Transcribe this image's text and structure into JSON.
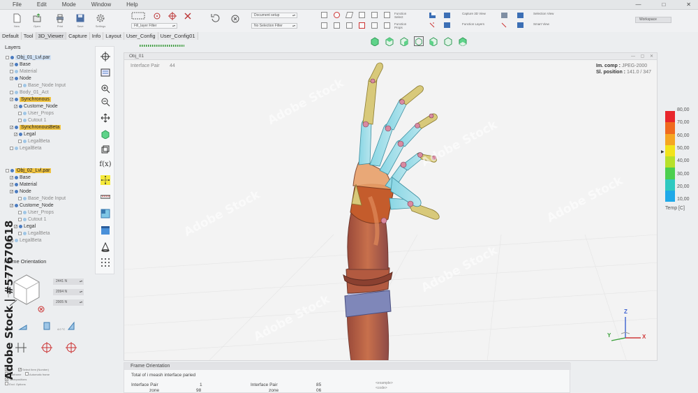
{
  "menu": [
    "File",
    "Edit",
    "Mode",
    "Window",
    "Help"
  ],
  "ribbon": {
    "buttons": [
      "New",
      "Open",
      "Print",
      "Save",
      "Settings"
    ],
    "layer_filter": "Fill_layer Filter",
    "document_setup": "Document setup",
    "selection_filter": "No Selection Filter",
    "function_select": "Function Select",
    "function_props": "Function Props",
    "capture_3d_view": "Capture 3D View",
    "function_layers": "Function Layers",
    "selection_view": "Selection View",
    "smart_view": "Smart View",
    "workspace": "Workspace"
  },
  "tabs": [
    "Default",
    "Tool",
    "3D_Viewer",
    "Capture",
    "Info",
    "Layout",
    "User_Config",
    "User_Config01"
  ],
  "layers": {
    "title": "Layers",
    "tree": [
      {
        "label": "Obj_01_Lvl.par",
        "style": "blue",
        "indent": 0
      },
      {
        "label": "Base",
        "indent": 1
      },
      {
        "label": "Material",
        "indent": 1,
        "dim": true
      },
      {
        "label": "Node",
        "indent": 1
      },
      {
        "label": "Base_Node Input",
        "indent": 3,
        "dim": true
      },
      {
        "label": "Body_01_Act",
        "indent": 1,
        "dim": true
      },
      {
        "label": "Synchronous",
        "indent": 1,
        "style": "yellow"
      },
      {
        "label": "Custome_Node",
        "indent": 2
      },
      {
        "label": "User_Props",
        "indent": 3,
        "dim": true
      },
      {
        "label": "Cutout 1",
        "indent": 3,
        "dim": true
      },
      {
        "label": "SynchronousBeta",
        "indent": 1,
        "style": "yellow"
      },
      {
        "label": "Legal",
        "indent": 2
      },
      {
        "label": "LegalBeta",
        "indent": 3,
        "dim": true
      },
      {
        "label": "LegalBeta",
        "indent": 1,
        "dim": true
      },
      {
        "label": "Obj_02_Lvl.par",
        "style": "yellow",
        "indent": 0
      },
      {
        "label": "Base",
        "indent": 1
      },
      {
        "label": "Material",
        "indent": 1
      },
      {
        "label": "Node",
        "indent": 1
      },
      {
        "label": "Base_Node Input",
        "indent": 3,
        "dim": true
      },
      {
        "label": "Custome_Node",
        "indent": 1
      },
      {
        "label": "User_Props",
        "indent": 3,
        "dim": true
      },
      {
        "label": "Cutout 1",
        "indent": 3,
        "dim": true
      },
      {
        "label": "Legal",
        "indent": 2
      },
      {
        "label": "LegalBeta",
        "indent": 3,
        "dim": true
      },
      {
        "label": "LegalBeta",
        "indent": 1,
        "dim": true
      }
    ]
  },
  "frame_orientation": {
    "title": "Frame Orientation",
    "values": [
      "2441 N",
      "2094 N",
      "2005 N"
    ],
    "angles": [
      "7.0 °C",
      "4.0 °C"
    ],
    "options": [
      "Rel.",
      "Select Item (Number)",
      "Automatic frame",
      "Subframe",
      "Tablepositions",
      "Excl. Options"
    ]
  },
  "viewport": {
    "title": "Obj_01",
    "interface_pair_label": "Interface Pair",
    "interface_pair_value": "44",
    "im_comp_label": "Im. comp :",
    "im_comp_value": "JPEG-2000",
    "sl_position_label": "Sl. position :",
    "sl_position_value": "141.0 / 347",
    "axis_z": "Z",
    "axis_y": "Y",
    "axis_x": "X"
  },
  "colorbar": {
    "labels": [
      "80,00",
      "70,00",
      "60,00",
      "50,00",
      "40,00",
      "30,00",
      "20,00",
      "10,00"
    ],
    "unit": "Temp [C]",
    "colors": [
      "#e8262c",
      "#f06a1f",
      "#f5a623",
      "#f2e31b",
      "#b7e02a",
      "#4ccf4f",
      "#2fc9c0",
      "#1fa9e8"
    ]
  },
  "bottom_panel": {
    "title": "Frame Orientation",
    "summary": "Total of i meash interface paried",
    "rows": [
      {
        "l1": "Interface Pair",
        "v1": "1",
        "l2": "Interface Pair",
        "v2": "85"
      },
      {
        "l1": "zone",
        "v1": "98",
        "l2": "zone",
        "v2": "06"
      }
    ],
    "code": [
      "<example>",
      "<code>"
    ]
  },
  "watermark": {
    "brand": "Adobe Stock",
    "side_text": "Adobe Stock | #577670618"
  }
}
